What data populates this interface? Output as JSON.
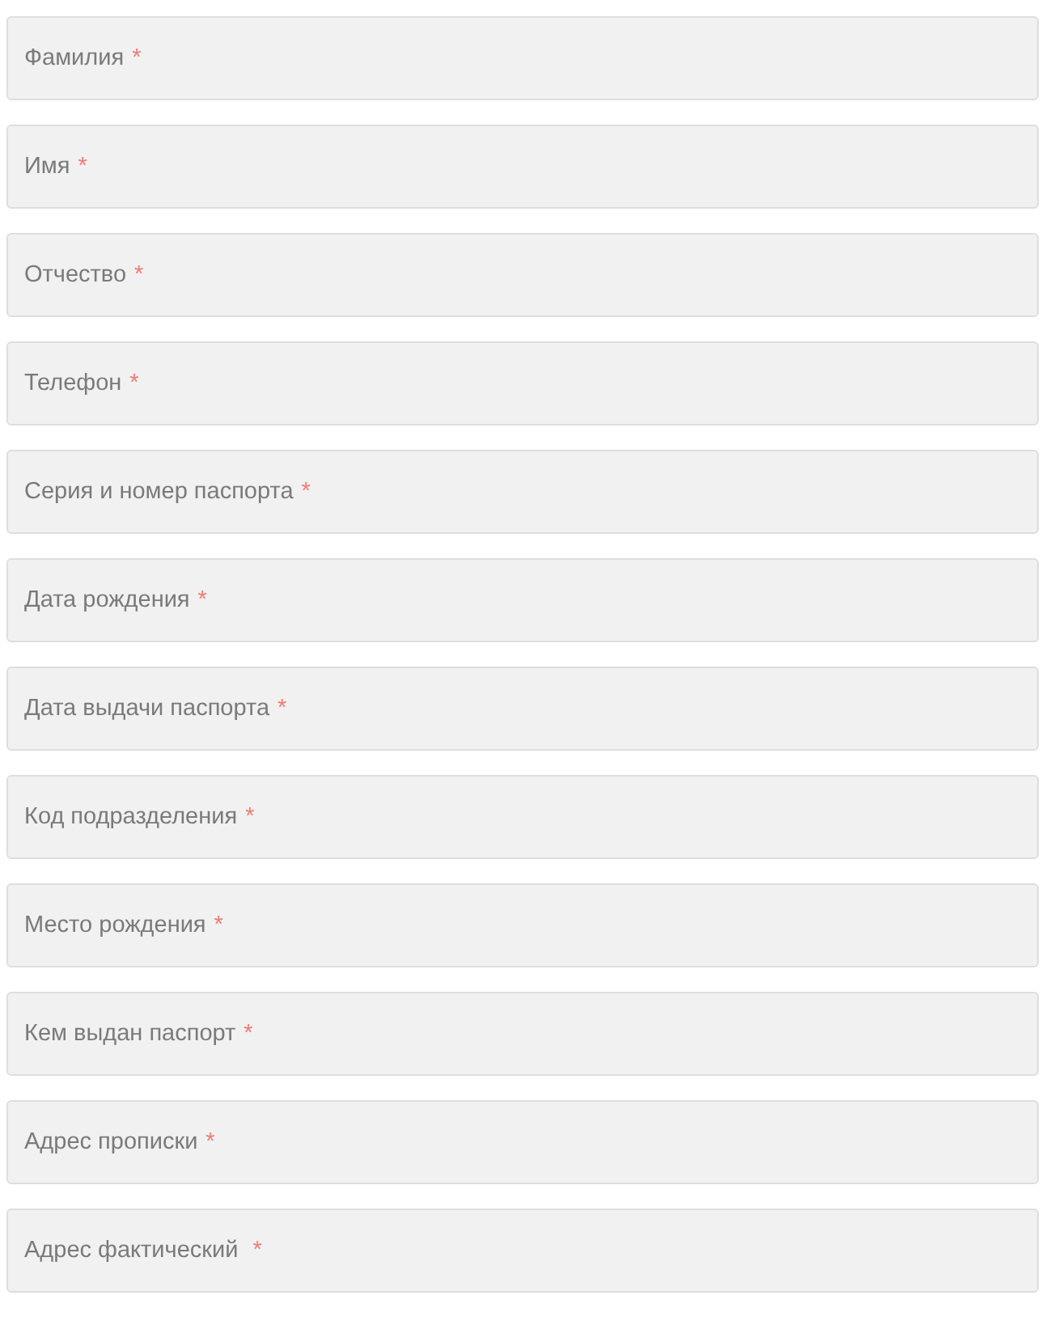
{
  "fields": [
    {
      "placeholder": "Фамилия",
      "required": true
    },
    {
      "placeholder": "Имя",
      "required": true
    },
    {
      "placeholder": "Отчество",
      "required": true
    },
    {
      "placeholder": "Телефон",
      "required": true
    },
    {
      "placeholder": "Серия и номер паспорта",
      "required": true
    },
    {
      "placeholder": "Дата рождения",
      "required": true
    },
    {
      "placeholder": "Дата выдачи паспорта",
      "required": true
    },
    {
      "placeholder": "Код подразделения",
      "required": true
    },
    {
      "placeholder": "Место рождения",
      "required": true
    },
    {
      "placeholder": "Кем выдан паспорт",
      "required": true
    },
    {
      "placeholder": "Адрес прописки",
      "required": true
    },
    {
      "placeholder": "Адрес фактический ",
      "required": true
    }
  ],
  "required_mark": "*"
}
